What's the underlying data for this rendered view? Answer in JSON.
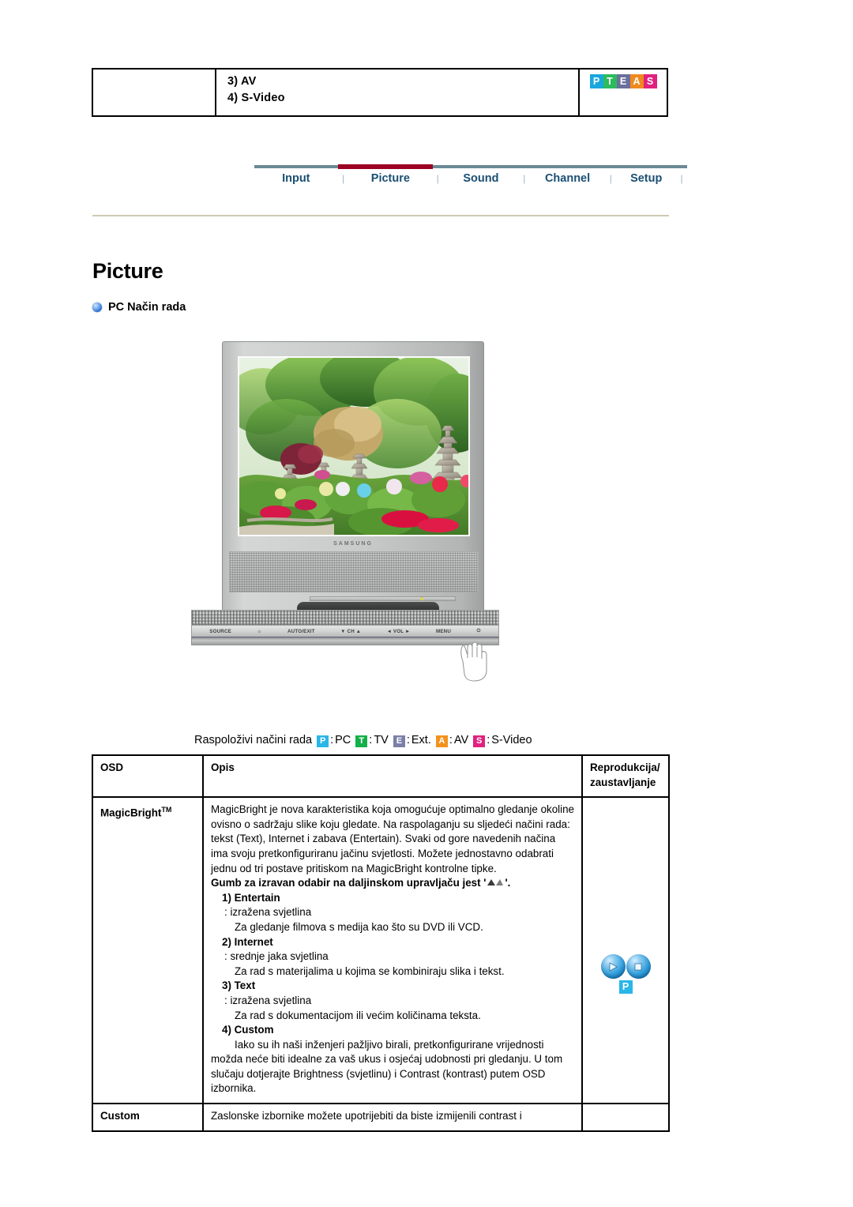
{
  "header": {
    "lines": [
      "3) AV",
      "4) S-Video"
    ],
    "logo": {
      "name": "pteas-logo",
      "letters": [
        {
          "char": "P",
          "color": "#1aa7dd"
        },
        {
          "char": "T",
          "color": "#2cbb5d"
        },
        {
          "char": "E",
          "color": "#6a6f9c"
        },
        {
          "char": "A",
          "color": "#f08a1e"
        },
        {
          "char": "S",
          "color": "#e0217f"
        }
      ]
    }
  },
  "nav": {
    "items": [
      "Input",
      "Picture",
      "Sound",
      "Channel",
      "Setup"
    ],
    "active": "Picture",
    "separator": "|",
    "active_color": "#9c0023",
    "line_color": "#6a8a94",
    "text_color": "#1b4f72"
  },
  "main": {
    "page_title": "Picture",
    "subheading": "PC Način rada"
  },
  "monitor": {
    "brand": "SAMSUNG",
    "controls": [
      "SOURCE",
      "AUTO/EXIT",
      "▼ CH ▲",
      "◄ VOL ►",
      "MENU",
      "⏻"
    ]
  },
  "legend": {
    "label": "Raspoloživi načini rada",
    "items": [
      {
        "badge": "P",
        "color": "#29b6e8",
        "label": "PC"
      },
      {
        "badge": "T",
        "color": "#14b04a",
        "label": "TV"
      },
      {
        "badge": "E",
        "color": "#7a80a6",
        "label": "Ext."
      },
      {
        "badge": "A",
        "color": "#f2921d",
        "label": "AV"
      },
      {
        "badge": "S",
        "color": "#e0217f",
        "label": "S-Video"
      }
    ],
    "colon": ":"
  },
  "table": {
    "headers": {
      "osd": "OSD",
      "opis": "Opis",
      "reprodukcija_line1": "Reprodukcija/",
      "reprodukcija_line2": "zaustavljanje"
    },
    "rows": [
      {
        "osd": "MagicBright",
        "osd_sup": "TM",
        "intro": "MagicBright je nova karakteristika koja omogućuje optimalno gledanje okoline ovisno o sadržaju slike koju gledate. Na raspolaganju su sljedeći načini rada: tekst (Text), Internet i zabava (Entertain). Svaki od gore navedenih načina ima svoju pretkonfiguriranu jačinu svjetlosti. Možete jednostavno odabrati jednu od tri postave pritiskom na MagicBright kontrolne tipke.",
        "strong_prefix": "Gumb za izravan odabir na daljinskom upravljaču jest '",
        "strong_suffix": "'.",
        "items": [
          {
            "num": "1) Entertain",
            "colon": ": izražena svjetlina",
            "desc": "Za gledanje filmova s medija kao što su DVD ili VCD."
          },
          {
            "num": "2) Internet",
            "colon": ": srednje jaka svjetlina",
            "desc": "Za rad s materijalima u kojima se kombiniraju slika i tekst."
          },
          {
            "num": "3) Text",
            "colon": ": izražena svjetlina",
            "desc": "Za rad s dokumentacijom ili većim količinama teksta."
          }
        ],
        "custom_heading": "4) Custom",
        "custom_text": "Iako su ih naši inženjeri pažljivo birali, pretkonfigurirane vrijednosti možda neće biti idealne za vaš ukus i osjećaj udobnosti pri gledanju. U tom slučaju dotjerajte Brightness (svjetlinu) i Contrast (kontrast) putem OSD izbornika.",
        "reproduction": {
          "play_icon": "play-icon",
          "stop_icon": "stop-icon",
          "badge": "P",
          "badge_color": "#29b6e8"
        }
      },
      {
        "osd": "Custom",
        "opis": "Zaslonske izbornike možete upotrijebiti da biste izmijenili contrast i"
      }
    ]
  }
}
